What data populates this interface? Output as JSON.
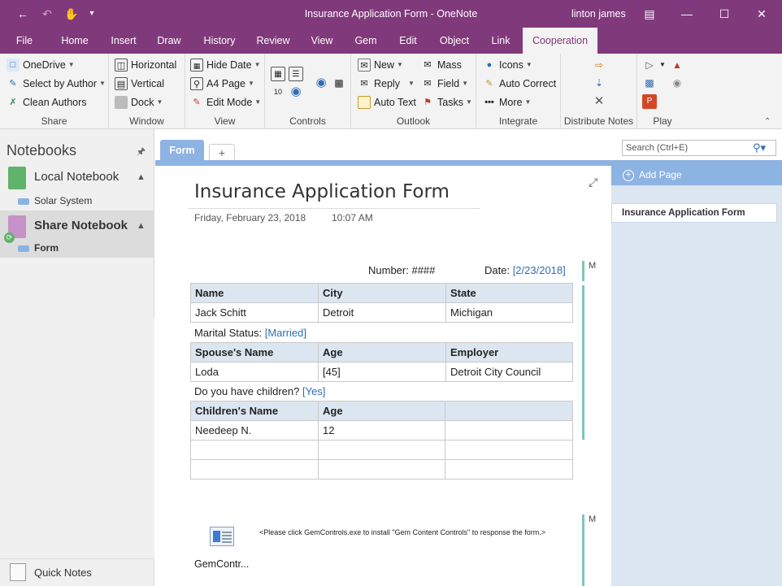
{
  "window": {
    "title": "Insurance Application Form  -  OneNote",
    "user": "linton james",
    "accent": "#80397b"
  },
  "ribbon": {
    "tabs": [
      "File",
      "Home",
      "Insert",
      "Draw",
      "History",
      "Review",
      "View",
      "Gem",
      "Edit",
      "Object",
      "Link",
      "Cooperation"
    ],
    "active_tab": "Cooperation",
    "groups": {
      "share": {
        "label": "Share",
        "items": [
          "OneDrive",
          "Select by Author",
          "Clean Authors"
        ]
      },
      "window": {
        "label": "Window",
        "items": [
          "Horizontal",
          "Vertical",
          "Dock"
        ]
      },
      "view": {
        "label": "View",
        "items": [
          "Hide Date",
          "A4 Page",
          "Edit Mode"
        ]
      },
      "controls": {
        "label": "Controls"
      },
      "outlook": {
        "label": "Outlook",
        "items": [
          "New",
          "Reply",
          "Auto Text",
          "Mass",
          "Field",
          "Tasks"
        ]
      },
      "integrate": {
        "label": "Integrate",
        "items": [
          "Icons",
          "Auto Correct",
          "More"
        ]
      },
      "distribute": {
        "label": "Distribute Notes"
      },
      "play": {
        "label": "Play"
      }
    }
  },
  "nav": {
    "heading": "Notebooks",
    "notebooks": [
      {
        "name": "Local Notebook",
        "color": "#5fb36b",
        "sections": [
          "Solar System"
        ]
      },
      {
        "name": "Share Notebook",
        "color": "#c792c8",
        "sections": [
          "Form"
        ]
      }
    ],
    "quick_notes": "Quick Notes"
  },
  "section_tab": "Form",
  "search": {
    "placeholder": "Search (Ctrl+E)"
  },
  "pages": {
    "add_label": "Add Page",
    "items": [
      "Insurance Application Form"
    ]
  },
  "page": {
    "title": "Insurance Application Form",
    "date": "Friday, February 23, 2018",
    "time": "10:07 AM",
    "number_label": "Number: ####",
    "date_label": "Date: ",
    "date_value": "[2/23/2018]",
    "marker": "M",
    "table1": {
      "headers": [
        "Name",
        "City",
        "State"
      ],
      "rows": [
        [
          "Jack Schitt",
          "Detroit",
          "Michigan"
        ]
      ]
    },
    "marital_label": "Marital Status: ",
    "marital_value": "[Married]",
    "table2": {
      "headers": [
        "Spouse's Name",
        "Age",
        "Employer"
      ],
      "rows": [
        [
          "Loda",
          "[45]",
          "Detroit City Council"
        ]
      ]
    },
    "children_label": "Do you have children? ",
    "children_value": "[Yes]",
    "table3": {
      "headers": [
        "Children's Name",
        "Age",
        ""
      ],
      "rows": [
        [
          "Needeep N.",
          "12",
          ""
        ],
        [
          "",
          "",
          ""
        ],
        [
          "",
          "",
          ""
        ]
      ]
    },
    "attachment_name": "GemContr...",
    "attachment_note": "<Please click GemControls.exe to install \"Gem Content Controls\" to response the form.>"
  }
}
